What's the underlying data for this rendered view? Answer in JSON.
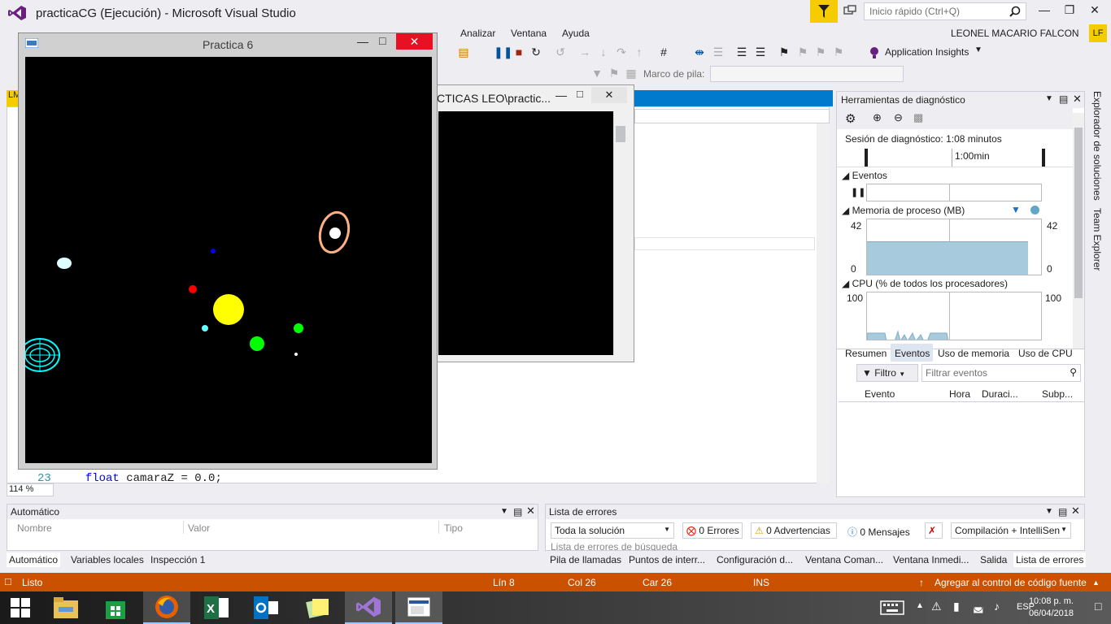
{
  "titlebar": {
    "title": "practicaCG (Ejecución) - Microsoft Visual Studio",
    "quicklaunch_placeholder": "Inicio rápido (Ctrl+Q)"
  },
  "menubar": {
    "items": [
      "Analizar",
      "Ventana",
      "Ayuda"
    ],
    "user": "LEONEL MACARIO FALCON",
    "user_initials": "LF"
  },
  "toolbar": {
    "insights_label": "Application Insights",
    "frame_label": "Marco de pila:"
  },
  "editor": {
    "line_number": "23",
    "code_keyword": "float",
    "code_rest": " camaraZ = 0.0;",
    "zoom": "114 %",
    "left_tab_label": "LM"
  },
  "console": {
    "title": "CTICAS LEO\\practic..."
  },
  "glwindow": {
    "title": "Practica 6"
  },
  "diagnostics": {
    "title": "Herramientas de diagnóstico",
    "session": "Sesión de diagnóstico: 1:08 minutos",
    "timeline_label": "1:00min",
    "events_label": "Eventos",
    "memory_label": "Memoria de proceso (MB)",
    "memory_max": "42",
    "memory_min": "0",
    "memory_level": 0.6,
    "cpu_label": "CPU (% de todos los procesadores)",
    "cpu_max": "100",
    "tabs": [
      "Resumen",
      "Eventos",
      "Uso de memoria",
      "Uso de CPU"
    ],
    "filter_label": "Filtro",
    "filter_placeholder": "Filtrar eventos",
    "columns": [
      "Evento",
      "Hora",
      "Duraci...",
      "Subp..."
    ]
  },
  "side_tabs": [
    "Explorador de soluciones",
    "Team Explorer"
  ],
  "auto_panel": {
    "title": "Automático",
    "columns": [
      "Nombre",
      "Valor",
      "Tipo"
    ],
    "tabs": [
      "Automático",
      "Variables locales",
      "Inspección 1"
    ]
  },
  "error_panel": {
    "title": "Lista de errores",
    "scope": "Toda la solución",
    "errors": "0 Errores",
    "warnings": "0 Advertencias",
    "messages": "0 Mensajes",
    "build": "Compilación + IntelliSen",
    "search_placeholder": "Lista de errores de búsqueda",
    "tabs": [
      "Pila de llamadas",
      "Puntos de interr...",
      "Configuración d...",
      "Ventana Coman...",
      "Ventana Inmedi...",
      "Salida",
      "Lista de errores"
    ]
  },
  "statusbar": {
    "status": "Listo",
    "line": "Lín 8",
    "col": "Col 26",
    "car": "Car 26",
    "ins": "INS",
    "source_control": "Agregar al control de código fuente"
  },
  "taskbar": {
    "lang": "ESP",
    "time": "10:08 p. m.",
    "date": "06/04/2018"
  },
  "colors": {
    "accent": "#007ACC",
    "status": "#CA5100",
    "filter": "#F5CC00"
  }
}
